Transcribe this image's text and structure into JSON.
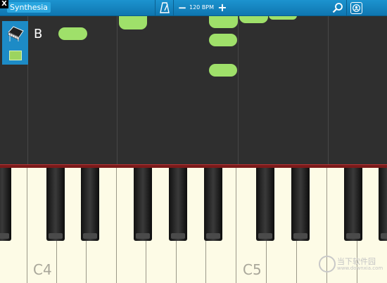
{
  "titlebar": {
    "close_label": "X",
    "app_title": "Synthesia"
  },
  "toolbar": {
    "minus": "−",
    "bpm_label": "120 BPM",
    "plus": "+"
  },
  "current_note": "B",
  "keyboard": {
    "labels": [
      "C4",
      "C5"
    ]
  },
  "watermark": {
    "text": "当下软件园",
    "sub": "www.downxia.com"
  },
  "colors": {
    "note": "#9fe06a",
    "topbar": "#1687c3",
    "panel": "#1d8bc6"
  },
  "icons": [
    "metronome-icon",
    "search-icon",
    "profile-icon",
    "piano-icon"
  ]
}
